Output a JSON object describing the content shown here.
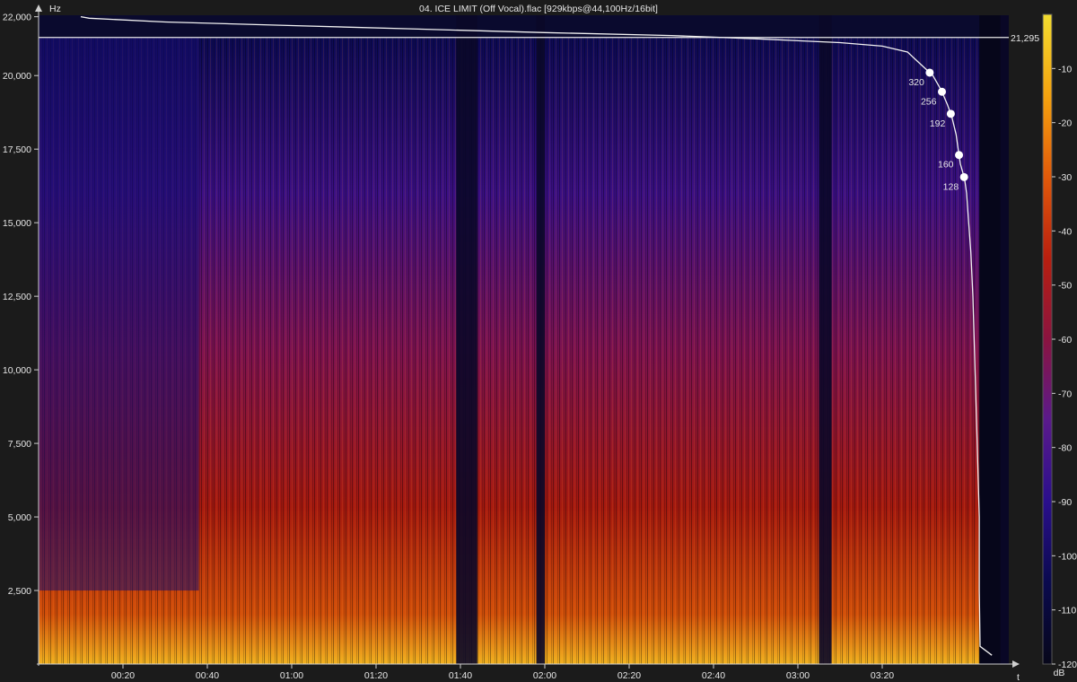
{
  "chart_data": {
    "type": "heatmap",
    "title": "04. ICE LIMIT (Off Vocal).flac [929kbps@44,100Hz/16bit]",
    "ylabel": "Hz",
    "xlabel": "t",
    "colorbar_label": "dB",
    "ylim": [
      0,
      22050
    ],
    "xlim_seconds": [
      0,
      230
    ],
    "y_ticks": [
      {
        "value": 2500,
        "label": "2,500"
      },
      {
        "value": 5000,
        "label": "5,000"
      },
      {
        "value": 7500,
        "label": "7,500"
      },
      {
        "value": 10000,
        "label": "10,000"
      },
      {
        "value": 12500,
        "label": "12,500"
      },
      {
        "value": 15000,
        "label": "15,000"
      },
      {
        "value": 17500,
        "label": "17,500"
      },
      {
        "value": 20000,
        "label": "20,000"
      },
      {
        "value": 22000,
        "label": "22,000"
      }
    ],
    "x_ticks": [
      {
        "value": 20,
        "label": "00:20"
      },
      {
        "value": 40,
        "label": "00:40"
      },
      {
        "value": 60,
        "label": "01:00"
      },
      {
        "value": 80,
        "label": "01:20"
      },
      {
        "value": 100,
        "label": "01:40"
      },
      {
        "value": 120,
        "label": "02:00"
      },
      {
        "value": 140,
        "label": "02:20"
      },
      {
        "value": 160,
        "label": "02:40"
      },
      {
        "value": 180,
        "label": "03:00"
      },
      {
        "value": 200,
        "label": "03:20"
      }
    ],
    "color_scale": {
      "range_db": [
        -120,
        0
      ],
      "ticks": [
        {
          "value": -10,
          "label": "-10"
        },
        {
          "value": -20,
          "label": "-20"
        },
        {
          "value": -30,
          "label": "-30"
        },
        {
          "value": -40,
          "label": "-40"
        },
        {
          "value": -50,
          "label": "-50"
        },
        {
          "value": -60,
          "label": "-60"
        },
        {
          "value": -70,
          "label": "-70"
        },
        {
          "value": -80,
          "label": "-80"
        },
        {
          "value": -90,
          "label": "-90"
        },
        {
          "value": -100,
          "label": "-100"
        },
        {
          "value": -110,
          "label": "-110"
        },
        {
          "value": -120,
          "label": "-120"
        }
      ],
      "colors": [
        "#07071a",
        "#0a0a4e",
        "#2a0f8c",
        "#5a1a8c",
        "#8a1440",
        "#b81f0f",
        "#e25a0a",
        "#f5a30f",
        "#f2dc30"
      ]
    },
    "cutoff_line": {
      "value": 21295,
      "label": "21,295"
    },
    "bitrate_markers": [
      {
        "label": "320",
        "frequency": 20100
      },
      {
        "label": "256",
        "frequency": 19450
      },
      {
        "label": "192",
        "frequency": 18700
      },
      {
        "label": "160",
        "frequency": 17300
      },
      {
        "label": "128",
        "frequency": 16550
      }
    ],
    "cutoff_curve": [
      [
        10,
        22000
      ],
      [
        12,
        21950
      ],
      [
        30,
        21820
      ],
      [
        60,
        21700
      ],
      [
        90,
        21580
      ],
      [
        120,
        21460
      ],
      [
        150,
        21360
      ],
      [
        170,
        21250
      ],
      [
        190,
        21120
      ],
      [
        200,
        21000
      ],
      [
        206,
        20800
      ],
      [
        209,
        20400
      ],
      [
        212,
        20000
      ],
      [
        214,
        19500
      ],
      [
        215.5,
        19000
      ],
      [
        216.5,
        18600
      ],
      [
        217.5,
        18000
      ],
      [
        218,
        17500
      ],
      [
        218.5,
        17000
      ],
      [
        219.5,
        16500
      ],
      [
        220,
        16000
      ],
      [
        220.5,
        15000
      ],
      [
        221,
        14000
      ],
      [
        221.5,
        12500
      ],
      [
        222,
        10000
      ],
      [
        222.5,
        7500
      ],
      [
        223,
        5000
      ],
      [
        223,
        2500
      ],
      [
        223.2,
        600
      ],
      [
        226,
        300
      ]
    ],
    "quiet_regions": [
      {
        "start": 99,
        "end": 104
      },
      {
        "start": 118,
        "end": 120
      },
      {
        "start": 185,
        "end": 188
      },
      {
        "start": 228,
        "end": 230
      }
    ],
    "sparse_regions": [
      {
        "start": 0,
        "end": 13,
        "top_hz": 21300
      },
      {
        "start": 13,
        "end": 38,
        "top_hz": 21300
      }
    ]
  }
}
